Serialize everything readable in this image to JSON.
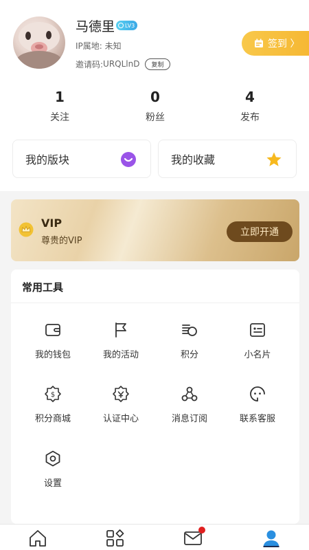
{
  "profile": {
    "name": "马德里",
    "level_badge": "LV3",
    "ip_location": "IP属地: 未知",
    "invite_label": "邀请码: ",
    "invite_code": "URQLlnD",
    "copy_label": "复制",
    "sign_in_label": "签到 〉"
  },
  "stats": [
    {
      "value": "1",
      "label": "关注"
    },
    {
      "value": "0",
      "label": "粉丝"
    },
    {
      "value": "4",
      "label": "发布"
    }
  ],
  "cards": [
    {
      "label": "我的版块",
      "icon": "chat-bubble-icon"
    },
    {
      "label": "我的收藏",
      "icon": "star-icon"
    }
  ],
  "vip": {
    "title": "VIP",
    "subtitle": "尊贵的VIP",
    "button": "立即开通"
  },
  "tools": {
    "title": "常用工具",
    "items": [
      {
        "label": "我的钱包",
        "icon": "wallet-icon"
      },
      {
        "label": "我的活动",
        "icon": "flag-icon"
      },
      {
        "label": "积分",
        "icon": "coins-icon"
      },
      {
        "label": "小名片",
        "icon": "id-card-icon"
      },
      {
        "label": "积分商城",
        "icon": "points-mall-icon"
      },
      {
        "label": "认证中心",
        "icon": "certification-icon"
      },
      {
        "label": "消息订阅",
        "icon": "subscription-icon"
      },
      {
        "label": "联系客服",
        "icon": "customer-service-icon"
      },
      {
        "label": "设置",
        "icon": "settings-icon"
      }
    ]
  },
  "tabbar": {
    "items": [
      {
        "icon": "home-icon"
      },
      {
        "icon": "apps-icon"
      },
      {
        "icon": "mail-icon",
        "has_badge": true
      },
      {
        "icon": "profile-icon",
        "active": true
      }
    ]
  },
  "colors": {
    "accent": "#f6b834",
    "tab_active": "#2a8fe0",
    "vip_button": "#6e4a1e",
    "badge": "#e02020"
  }
}
